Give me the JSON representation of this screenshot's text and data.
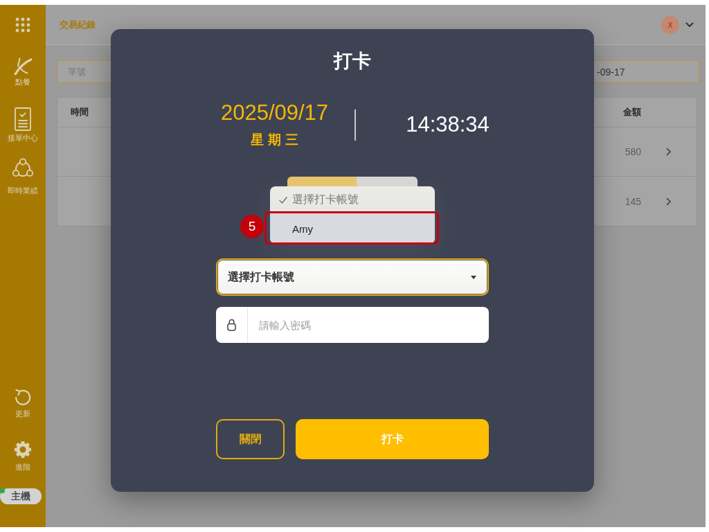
{
  "sidebar": {
    "items": [
      {
        "label": "點餐"
      },
      {
        "label": "接單中心"
      },
      {
        "label": "即時業績"
      }
    ],
    "bottom_items": [
      {
        "label": "更新"
      },
      {
        "label": "進階"
      }
    ],
    "host": {
      "label": "主機",
      "connected": true
    }
  },
  "header": {
    "title": "交易紀錄",
    "avatar": "x"
  },
  "filters": {
    "order_number": {
      "placeholder": "單號"
    },
    "date": {
      "value": "-09-17"
    }
  },
  "table": {
    "columns": [
      "時間",
      "金額"
    ],
    "rows": [
      {
        "amount": "580"
      },
      {
        "amount": "145"
      }
    ]
  },
  "dialog": {
    "title": "打卡",
    "date": "2025/09/17",
    "weekday": "星期三",
    "time": "14:38:34",
    "account_menu": {
      "options": [
        {
          "label": "選擇打卡帳號",
          "selected": true
        },
        {
          "label": "Amy",
          "selected": false,
          "callout": "5"
        }
      ]
    },
    "account_select": {
      "value": "選擇打卡帳號",
      "focused": true
    },
    "password": {
      "placeholder": "請輸入密碼"
    },
    "buttons": [
      {
        "label": "關閉",
        "kind": "outline"
      },
      {
        "label": "打卡",
        "kind": "filled"
      }
    ]
  }
}
